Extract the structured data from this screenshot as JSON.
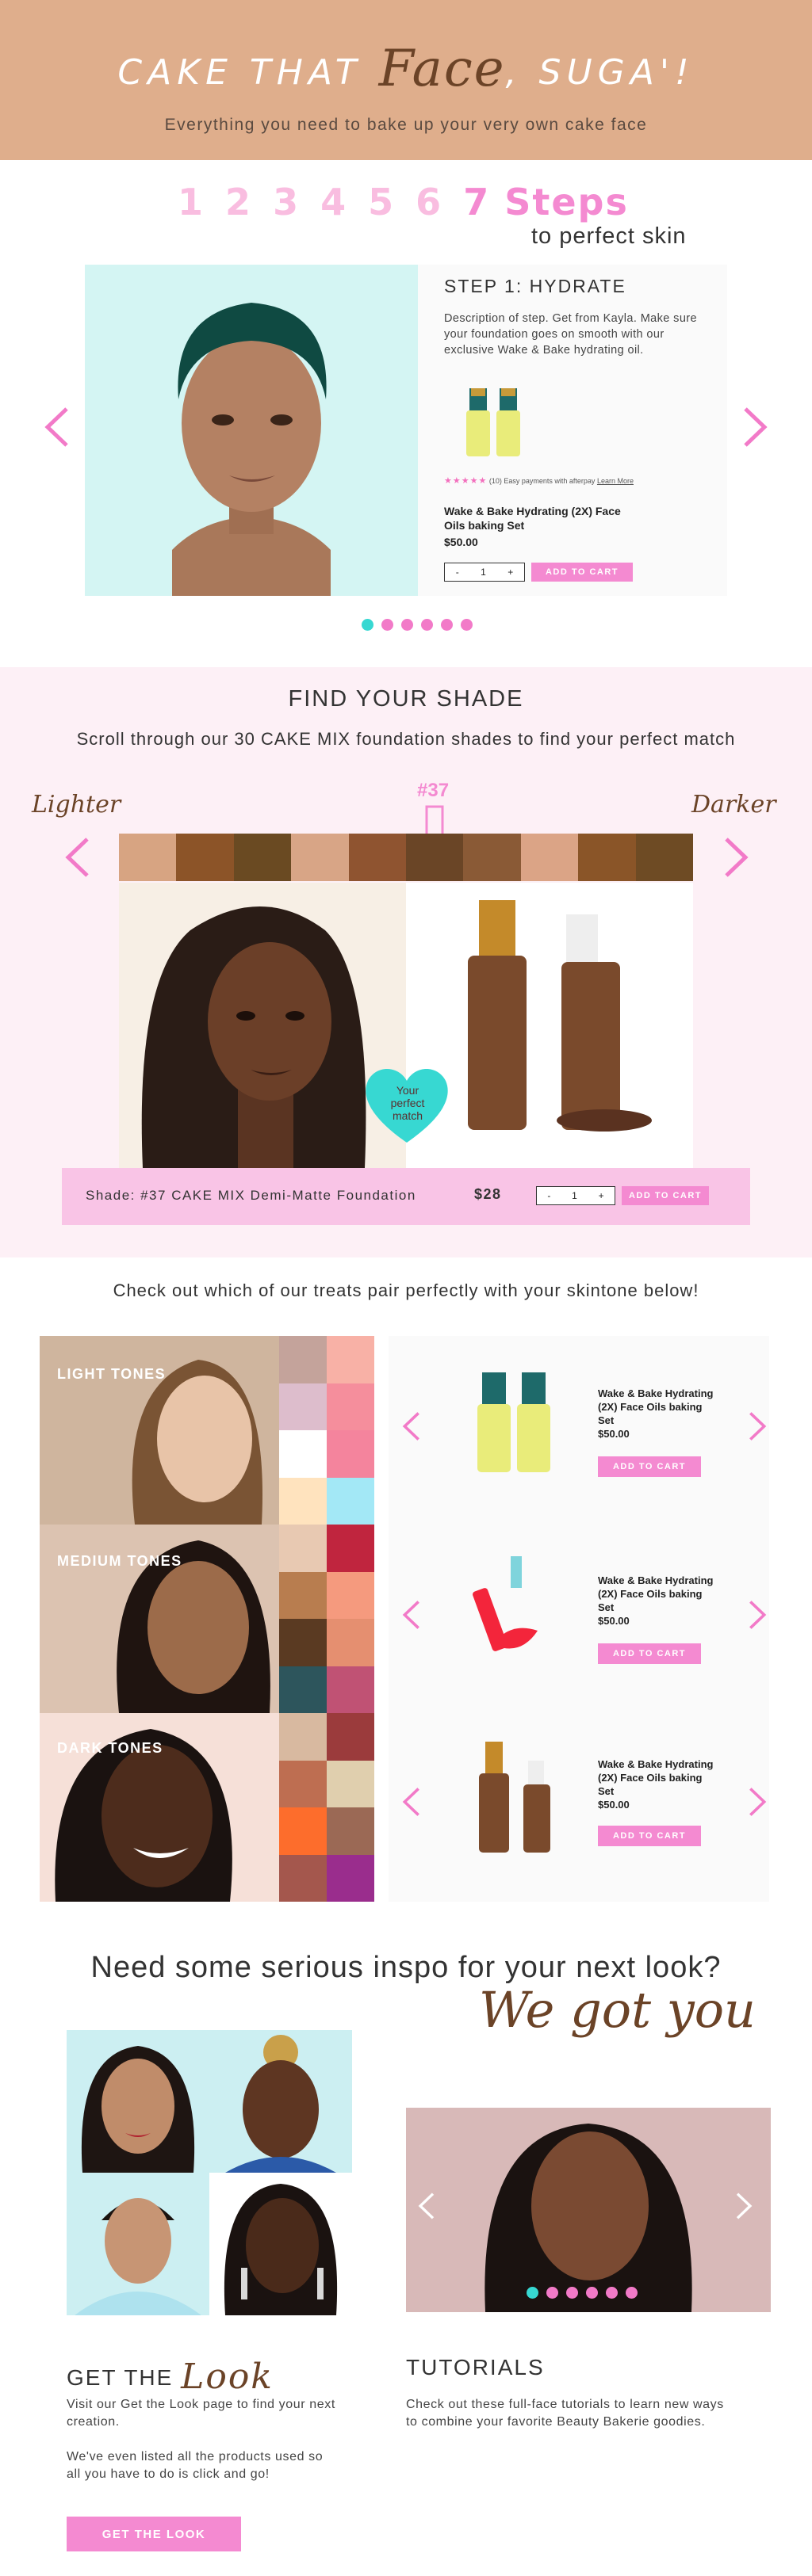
{
  "header": {
    "title_part1": "CAKE THAT",
    "title_script": "Face",
    "title_part2": ", SUGA'!",
    "subtitle": "Everything you need to bake up your very own cake face"
  },
  "steps": {
    "numbers": [
      "1",
      "2",
      "3",
      "4",
      "5",
      "6"
    ],
    "highlight": "7 Steps",
    "subheading": "to perfect skin",
    "current": {
      "title": "STEP 1: HYDRATE",
      "description": "Description of step. Get from Kayla. Make sure your foundation goes on smooth with our exclusive Wake & Bake hydrating oil.",
      "rating_stars": "★★★★★",
      "rating_count": "(10)",
      "payment_text": "Easy payments with afterpay",
      "learn_more": "Learn More",
      "product_name": "Wake & Bake Hydrating (2X) Face Oils baking Set",
      "price": "$50.00",
      "qty_minus": "-",
      "qty_value": "1",
      "qty_plus": "+",
      "cart_label": "ADD TO CART"
    },
    "dots_total": 6,
    "active_dot": 0
  },
  "shade": {
    "title": "FIND YOUR SHADE",
    "subtitle": "Scroll through our 30 CAKE MIX foundation shades to find your perfect match",
    "lighter": "Lighter",
    "darker": "Darker",
    "selected_number": "#37",
    "swatches": [
      "#d7a482",
      "#8c5428",
      "#6a4a22",
      "#d8a586",
      "#8f5430",
      "#6a4526",
      "#8a5a36",
      "#dba486",
      "#8a5528",
      "#6e4b24"
    ],
    "heart_text": "Your perfect match",
    "bar_label": "Shade: #37 CAKE MIX Demi-Matte Foundation",
    "bar_price": "$28",
    "qty_minus": "-",
    "qty_value": "1",
    "qty_plus": "+",
    "cart_label": "ADD TO CART"
  },
  "treats": {
    "title": "Check out which of our treats pair perfectly with your skintone below!",
    "tones": [
      {
        "label": "LIGHT TONES",
        "palette": [
          "#c4a39b",
          "#f8b1a6",
          "#ddbdcc",
          "#f58e9c",
          "#ffffff",
          "#f4849d",
          "#ffe3be",
          "#a3e8f6"
        ],
        "product_name": "Wake & Bake Hydrating (2X) Face Oils baking Set",
        "price": "$50.00",
        "cart_label": "ADD TO CART"
      },
      {
        "label": "MEDIUM TONES",
        "palette": [
          "#e8c9b2",
          "#c0253e",
          "#b87d4f",
          "#f59a7e",
          "#5a3a22",
          "#e58f70",
          "#2d555c",
          "#c05274"
        ],
        "product_name": "Wake & Bake Hydrating (2X) Face Oils baking Set",
        "price": "$50.00",
        "cart_label": "ADD TO CART"
      },
      {
        "label": "DARK TONES",
        "palette": [
          "#d8b9a0",
          "#9b3b3c",
          "#be6e51",
          "#e0cfae",
          "#fd6d2c",
          "#9b6955",
          "#a4574d",
          "#9a2d8d"
        ],
        "product_name": "Wake & Bake Hydrating (2X) Face Oils baking Set",
        "price": "$50.00",
        "cart_label": "ADD TO CART"
      }
    ]
  },
  "inspo": {
    "title": "Need some serious inspo for your next look?",
    "script": "We got you",
    "get_look_prefix": "GET THE",
    "get_look_script": "Look",
    "get_look_p1": "Visit our Get the Look page to find your next creation.",
    "get_look_p2": "We've even listed all the products used so all you have to do is click and go!",
    "get_look_button": "GET THE LOOK",
    "tutorials_title": "TUTORIALS",
    "tutorials_text": "Check out these full-face tutorials to learn new ways to combine your favorite Beauty Bakerie goodies.",
    "video_dots_total": 6,
    "video_active_dot": 0
  },
  "colors": {
    "brand_tan": "#dfae8c",
    "accent_pink": "#f48ad1",
    "accent_teal": "#37d8d2",
    "brown_script": "#6b4327"
  }
}
